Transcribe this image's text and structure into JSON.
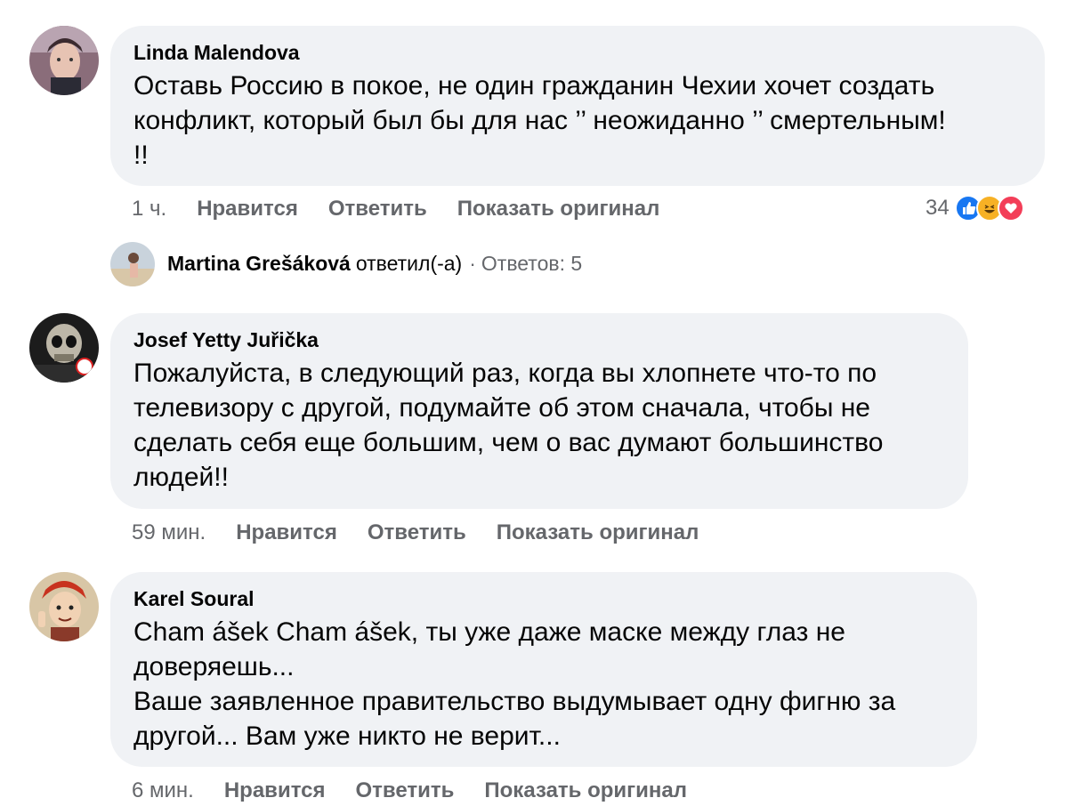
{
  "comments": [
    {
      "author": "Linda Malendova",
      "text": "Оставь Россию в покое, не один гражданин Чехии хочет создать\nконфликт, который был бы для нас ’’ неожиданно ’’ смертельным!\n!!",
      "time": "1 ч.",
      "like_label": "Нравится",
      "reply_label": "Ответить",
      "original_label": "Показать оригинал",
      "reaction_count": "34",
      "reactions": [
        "like-icon",
        "haha-icon",
        "love-icon"
      ]
    },
    {
      "author": "Josef Yetty Juřička",
      "text": "Пожалуйста, в следующий раз, когда вы хлопнете что-то по\nтелевизору с другой, подумайте об этом сначала, чтобы не\nсделать себя еще большим, чем о вас думают большинство\nлюдей!!",
      "time": "59 мин.",
      "like_label": "Нравится",
      "reply_label": "Ответить",
      "original_label": "Показать оригинал"
    },
    {
      "author": "Karel Soural",
      "text": "Cham ášek Cham ášek, ты уже даже маске между глаз не\nдоверяешь...\nВаше заявленное правительство выдумывает одну фигню за\nдругой... Вам уже никто не верит...",
      "time": "6 мин.",
      "like_label": "Нравится",
      "reply_label": "Ответить",
      "original_label": "Показать оригинал"
    }
  ],
  "reply_summary": {
    "name": "Martina Grešáková",
    "verb": "ответил(-а)",
    "separator": "·",
    "count_text": "Ответов: 5"
  },
  "colors": {
    "bubble": "#f0f2f5",
    "secondary_text": "#65676b",
    "like_blue": "#1877f2",
    "haha_yellow": "#f7b125",
    "love_red": "#f33e58"
  }
}
